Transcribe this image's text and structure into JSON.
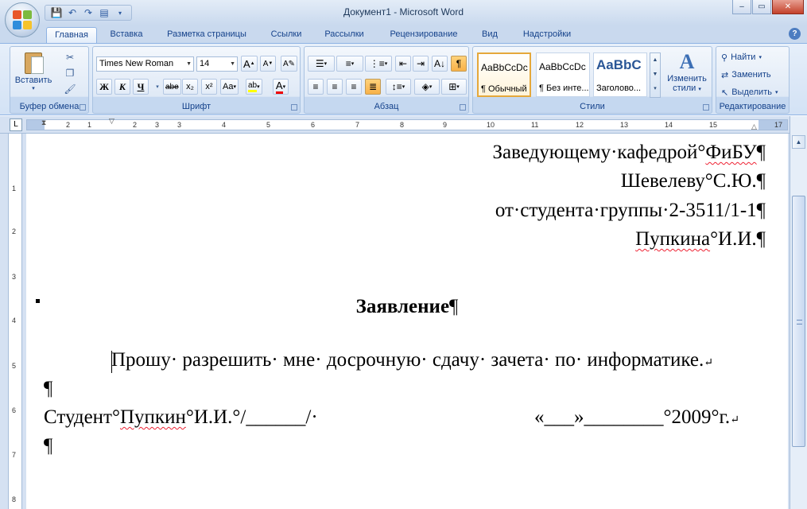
{
  "window": {
    "title": "Документ1 - Microsoft Word",
    "minimize_label": "‒",
    "maximize_label": "▭",
    "close_label": "✕"
  },
  "quick_access": {
    "icons": [
      "save-icon",
      "undo-icon",
      "redo-icon",
      "print-preview-icon",
      "customize-arrow-icon"
    ]
  },
  "tabs": [
    {
      "label": "Главная",
      "active": true
    },
    {
      "label": "Вставка"
    },
    {
      "label": "Разметка страницы"
    },
    {
      "label": "Ссылки"
    },
    {
      "label": "Рассылки"
    },
    {
      "label": "Рецензирование"
    },
    {
      "label": "Вид"
    },
    {
      "label": "Надстройки"
    }
  ],
  "ribbon": {
    "clipboard": {
      "group_label": "Буфер обмена",
      "paste_label": "Вставить"
    },
    "font": {
      "group_label": "Шрифт",
      "font_name": "Times New Roman",
      "font_size": "14",
      "bold": "Ж",
      "italic": "К",
      "underline": "Ч",
      "strike": "abe",
      "subscript": "x₂",
      "superscript": "x²",
      "change_case": "Aa",
      "grow": "A",
      "shrink": "A",
      "font_color": "A"
    },
    "paragraph": {
      "group_label": "Абзац",
      "pilcrow": "¶"
    },
    "styles": {
      "group_label": "Стили",
      "items": [
        {
          "preview": "AaBbCcDc",
          "name": "¶ Обычный",
          "selected": true
        },
        {
          "preview": "AaBbCcDc",
          "name": "¶ Без инте..."
        },
        {
          "preview": "AaBbC",
          "name": "Заголово..."
        }
      ],
      "change_styles_line1": "Изменить",
      "change_styles_line2": "стили"
    },
    "editing": {
      "group_label": "Редактирование",
      "find": "Найти",
      "replace": "Заменить",
      "select": "Выделить"
    }
  },
  "ruler": {
    "numbers": [
      "2",
      "1",
      "1",
      "2",
      "3",
      "4",
      "5",
      "6",
      "7",
      "8",
      "9",
      "10",
      "11",
      "12",
      "13",
      "14",
      "15",
      "17"
    ],
    "vertical_numbers": [
      "1",
      "1",
      "2",
      "3",
      "4",
      "5",
      "6",
      "7",
      "8"
    ]
  },
  "document": {
    "addressee_line1": "Заведующему·кафедрой°",
    "addressee_line1_wavy": "ФиБУ",
    "addressee_line2a": "Шевелеву",
    "addressee_line2b": "°С.Ю.",
    "addressee_line3": "от·студента·группы·2-3511/1-1",
    "addressee_line4a": "Пупкина",
    "addressee_line4b": "°И.И.",
    "heading": "Заявление",
    "body": "Прошу· разрешить· мне· досрочную· сдачу· зачета· по· информатике.",
    "signature_left_a": "Студент°",
    "signature_left_b": "Пупкин",
    "signature_left_c": "°И.И.°/______/·",
    "signature_right": "«___»________°2009°г.",
    "pilcrow": "¶",
    "line_break": "↵"
  }
}
